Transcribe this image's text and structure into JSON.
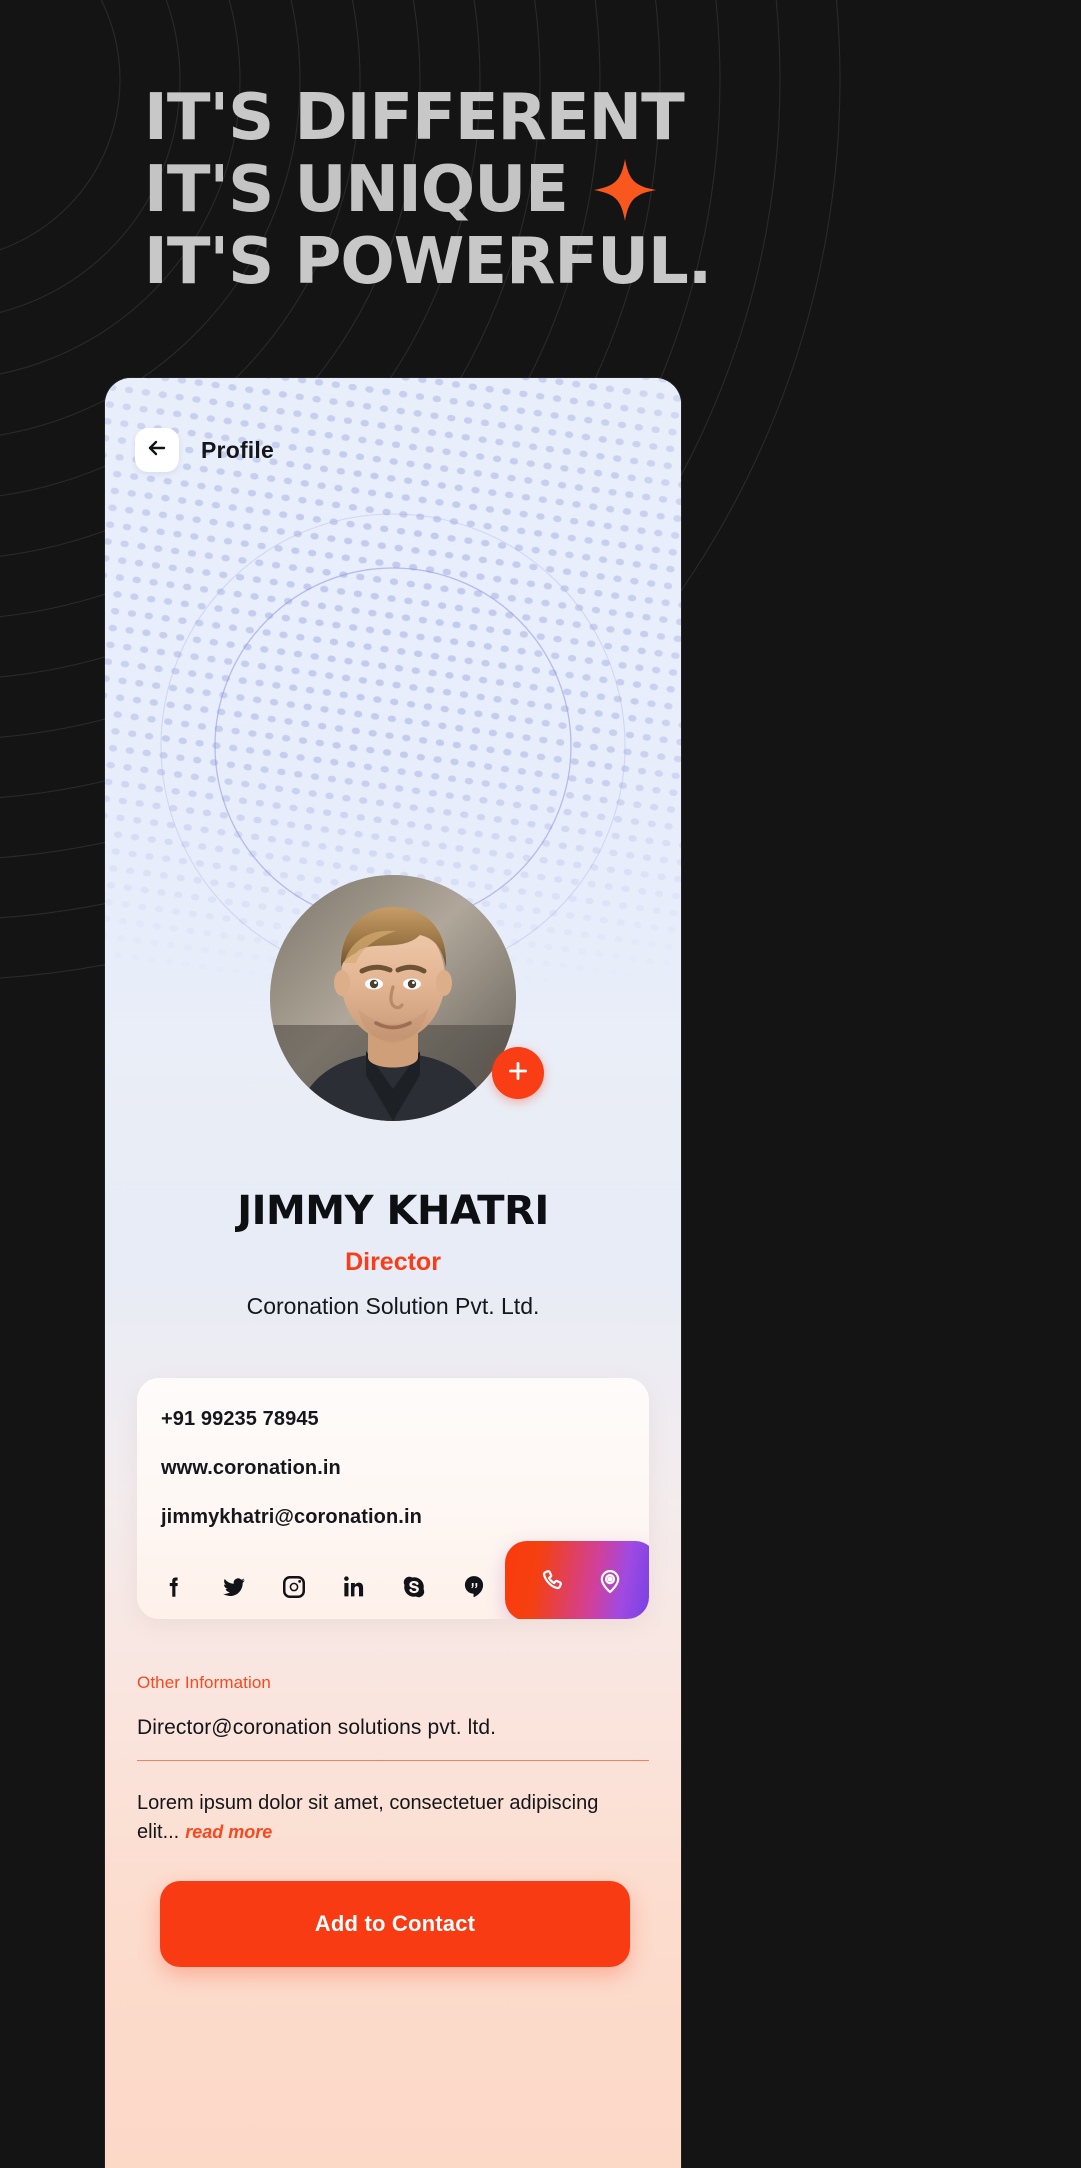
{
  "hero": {
    "line1": "IT'S DIFFERENT",
    "line2": "IT'S UNIQUE",
    "line3": "IT'S POWERFUL.",
    "sparkle_icon": "four-point-star-icon",
    "accent_color": "#F8571E",
    "text_color": "#C8C8C8",
    "background_color": "#141414"
  },
  "phone": {
    "header": {
      "back_icon": "arrow-left-icon",
      "title": "Profile"
    },
    "avatar": {
      "alt": "profile-photo",
      "add_icon": "plus-icon",
      "add_badge_color": "#F93D15"
    },
    "identity": {
      "name": "JIMMY KHATRI",
      "role": "Director",
      "role_color": "#FA3C18",
      "company": "Coronation Solution Pvt. Ltd."
    },
    "contact": {
      "phone": "+91 99235 78945",
      "website": "www.coronation.in",
      "email": "jimmykhatri@coronation.in",
      "socials": [
        {
          "name": "facebook-icon",
          "label": "Facebook"
        },
        {
          "name": "twitter-icon",
          "label": "Twitter"
        },
        {
          "name": "instagram-icon",
          "label": "Instagram"
        },
        {
          "name": "linkedin-icon",
          "label": "LinkedIn"
        },
        {
          "name": "skype-icon",
          "label": "Skype"
        },
        {
          "name": "hangouts-icon",
          "label": "Hangouts"
        }
      ],
      "actions": [
        {
          "name": "phone-call-icon",
          "label": "Call"
        },
        {
          "name": "location-pin-icon",
          "label": "Location"
        }
      ],
      "action_gradient_from": "#FC3A0C",
      "action_gradient_to": "#6C3FE8"
    },
    "other_information": {
      "title": "Other Information",
      "value": "Director@coronation solutions pvt. ltd.",
      "description": "Lorem ipsum dolor sit amet, consectetuer adipiscing elit...",
      "read_more": "read more",
      "accent_color": "#F8481F"
    },
    "cta": {
      "label": "Add to Contact",
      "color": "#F93B14"
    }
  }
}
